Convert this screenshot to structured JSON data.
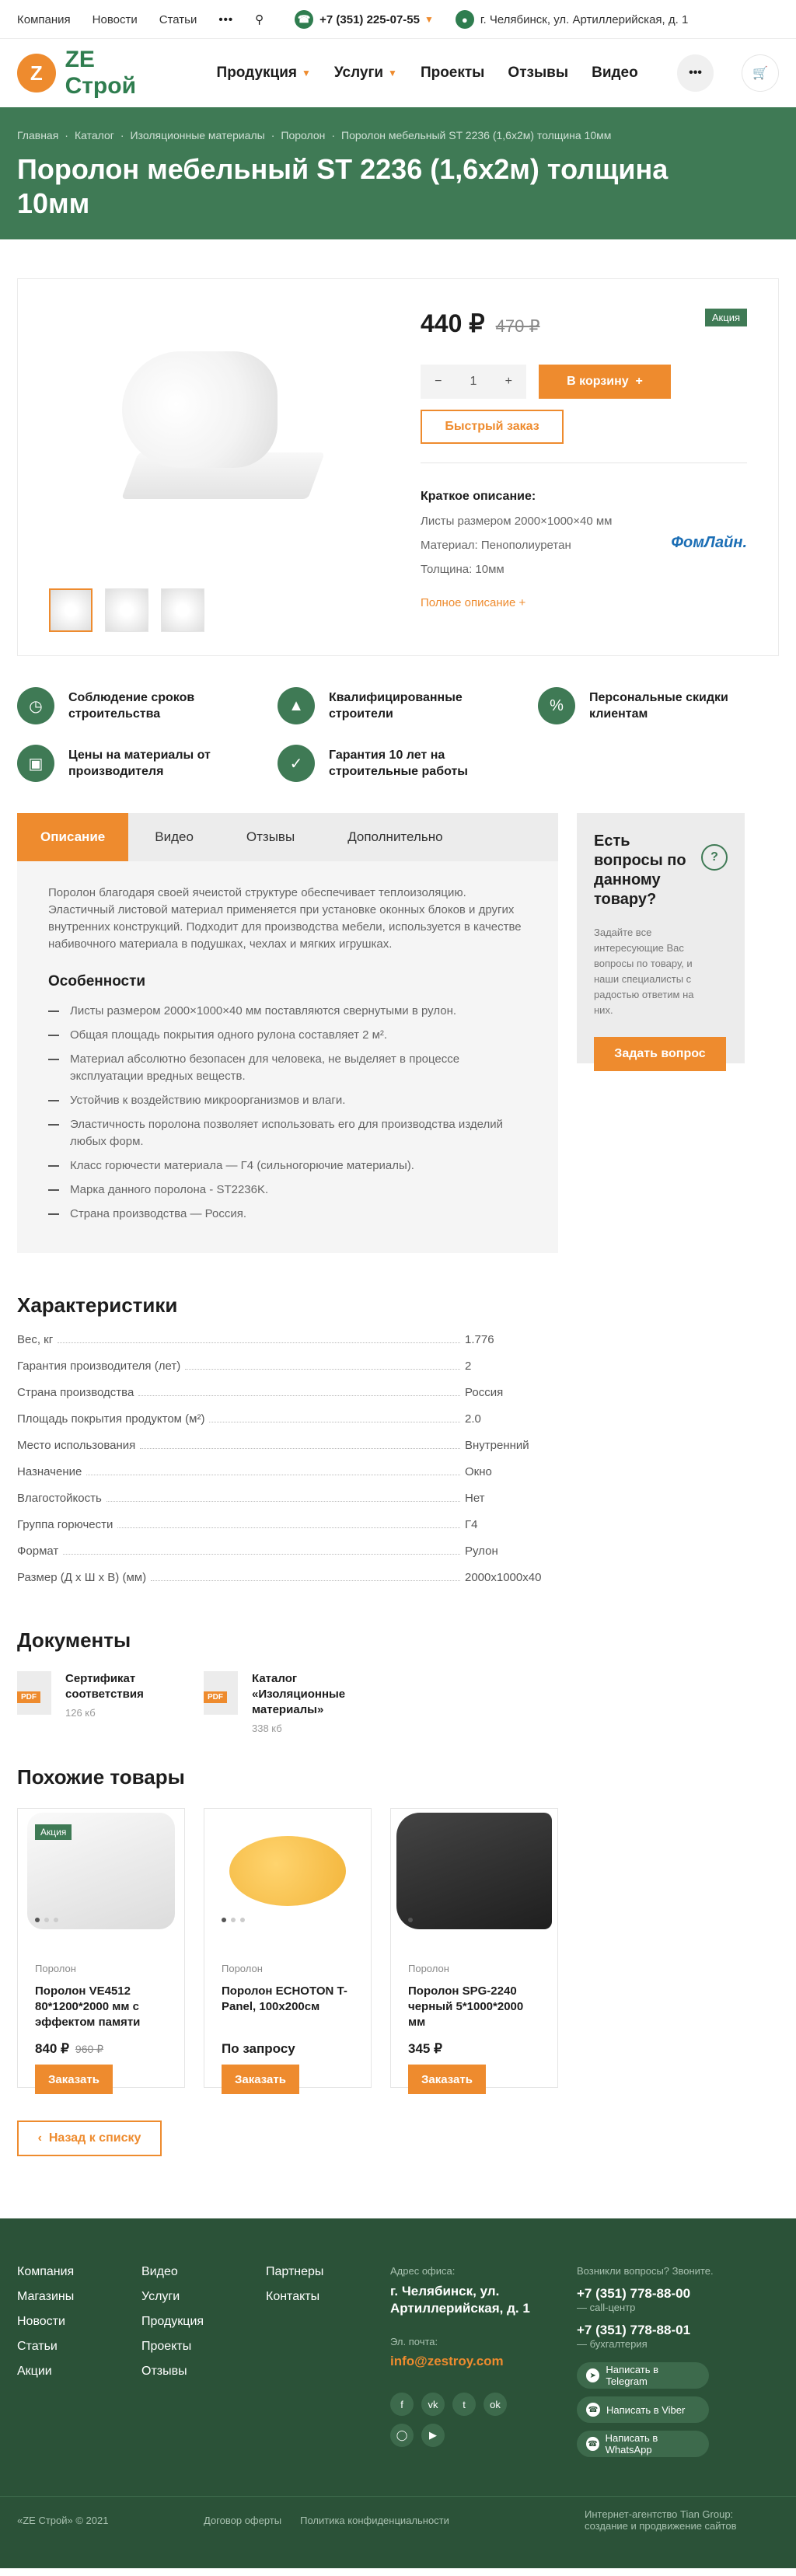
{
  "topbar": {
    "links": [
      "Компания",
      "Новости",
      "Статьи"
    ],
    "more": "•••",
    "phone": "+7 (351) 225-07-55",
    "address": "г. Челябинск, ул. Артиллерийская, д. 1"
  },
  "header": {
    "logo_mark": "Z",
    "logo_text": "ZE Строй",
    "nav": [
      "Продукция",
      "Услуги",
      "Проекты",
      "Отзывы",
      "Видео"
    ]
  },
  "breadcrumbs": [
    "Главная",
    "Каталог",
    "Изоляционные материалы",
    "Поролон",
    "Поролон мебельный ST 2236 (1,6х2м) толщина 10мм"
  ],
  "title": "Поролон мебельный ST 2236 (1,6х2м) толщина 10мм",
  "product": {
    "price": "440 ₽",
    "old_price": "470 ₽",
    "badge": "Акция",
    "qty": "1",
    "cart_label": "В корзину",
    "quick_label": "Быстрый заказ",
    "short_title": "Краткое описание:",
    "short_lines": [
      "Листы размером 2000×1000×40 мм",
      "Материал: Пенополиуретан",
      "Толщина: 10мм"
    ],
    "brand": "ФомЛайн.",
    "full_link": "Полное описание"
  },
  "advantages": [
    {
      "icon": "clock-icon",
      "text": "Соблюдение сроков строительства"
    },
    {
      "icon": "helmet-icon",
      "text": "Квалифицированные строители"
    },
    {
      "icon": "percent-icon",
      "text": "Персональные скидки клиентам"
    },
    {
      "icon": "wallet-icon",
      "text": "Цены на материалы от производителя"
    },
    {
      "icon": "check-icon",
      "text": "Гарантия 10 лет на строительные работы"
    }
  ],
  "tabs": [
    "Описание",
    "Видео",
    "Отзывы",
    "Дополнительно"
  ],
  "description": "Поролон благодаря своей ячеистой структуре обеспечивает теплоизоляцию. Эластичный листовой материал применяется при установке оконных блоков и других внутренних конструкций. Подходит для производства мебели, используется в качестве набивочного материала в подушках, чехлах и мягких игрушках.",
  "features_title": "Особенности",
  "features": [
    "Листы размером 2000×1000×40 мм поставляются свернутыми в рулон.",
    "Общая площадь покрытия одного рулона составляет 2 м².",
    "Материал абсолютно безопасен для человека, не выделяет в процессе эксплуатации вредных веществ.",
    "Устойчив к воздействию микроорганизмов и влаги.",
    "Эластичность поролона позволяет использовать его для производства изделий любых форм.",
    "Класс горючести материала — Г4 (сильногорючие материалы).",
    "Марка данного поролона - ST2236K.",
    "Страна производства — Россия."
  ],
  "ask": {
    "title": "Есть вопросы по данному товару?",
    "q": "?",
    "text": "Задайте все интересующие Вас вопросы по товару, и наши специалисты с радостью ответим на них.",
    "button": "Задать вопрос"
  },
  "chars_title": "Характеристики",
  "chars": [
    {
      "name": "Вес, кг",
      "value": "1.776"
    },
    {
      "name": "Гарантия производителя (лет)",
      "value": "2"
    },
    {
      "name": "Страна производства",
      "value": "Россия"
    },
    {
      "name": "Площадь покрытия продуктом (м²)",
      "value": "2.0"
    },
    {
      "name": "Место использования",
      "value": "Внутренний"
    },
    {
      "name": "Назначение",
      "value": "Окно"
    },
    {
      "name": "Влагостойкость",
      "value": "Нет"
    },
    {
      "name": "Группа горючести",
      "value": "Г4"
    },
    {
      "name": "Формат",
      "value": "Рулон"
    },
    {
      "name": "Размер (Д х Ш х В) (мм)",
      "value": "2000х1000х40"
    }
  ],
  "docs_title": "Документы",
  "docs": [
    {
      "tag": "PDF",
      "name": "Сертификат соответствия",
      "size": "126 кб"
    },
    {
      "tag": "PDF",
      "name": "Каталог «Изоляционные материалы»",
      "size": "338 кб"
    }
  ],
  "similar_title": "Похожие товары",
  "similar": [
    {
      "badge": "Акция",
      "cat": "Поролон",
      "name": "Поролон VE4512 80*1200*2000 мм с эффектом памяти",
      "price": "840 ₽",
      "old": "960 ₽",
      "button": "Заказать"
    },
    {
      "badge": "",
      "cat": "Поролон",
      "name": "Поролон ECHOTON T-Panel, 100х200см",
      "price": "По запросу",
      "old": "",
      "button": "Заказать"
    },
    {
      "badge": "",
      "cat": "Поролон",
      "name": "Поролон SPG-2240 черный 5*1000*2000 мм",
      "price": "345 ₽",
      "old": "",
      "button": "Заказать"
    }
  ],
  "back_label": "Назад к списку",
  "footer": {
    "col1": [
      "Компания",
      "Магазины",
      "Новости",
      "Статьи",
      "Акции"
    ],
    "col2": [
      "Видео",
      "Услуги",
      "Продукция",
      "Проекты",
      "Отзывы"
    ],
    "col3": [
      "Партнеры",
      "Контакты"
    ],
    "addr_label": "Адрес офиса:",
    "addr": "г. Челябинск, ул. Артиллерийская, д. 1",
    "mail_label": "Эл. почта:",
    "mail": "info@zestroy.com",
    "call_label": "Возникли вопросы? Звоните.",
    "phone1": "+7 (351) 778-88-00",
    "phone1_sub": "— call-центр",
    "phone2": "+7 (351) 778-88-01",
    "phone2_sub": "— бухгалтерия",
    "messengers": [
      "Написать в Telegram",
      "Написать в Viber",
      "Написать в WhatsApp"
    ],
    "copyright": "«ZE Строй» © 2021",
    "offer": "Договор оферты",
    "policy": "Политика конфиденциальности",
    "agency": "Интернет-агентство Tian Group: создание и продвижение сайтов"
  }
}
